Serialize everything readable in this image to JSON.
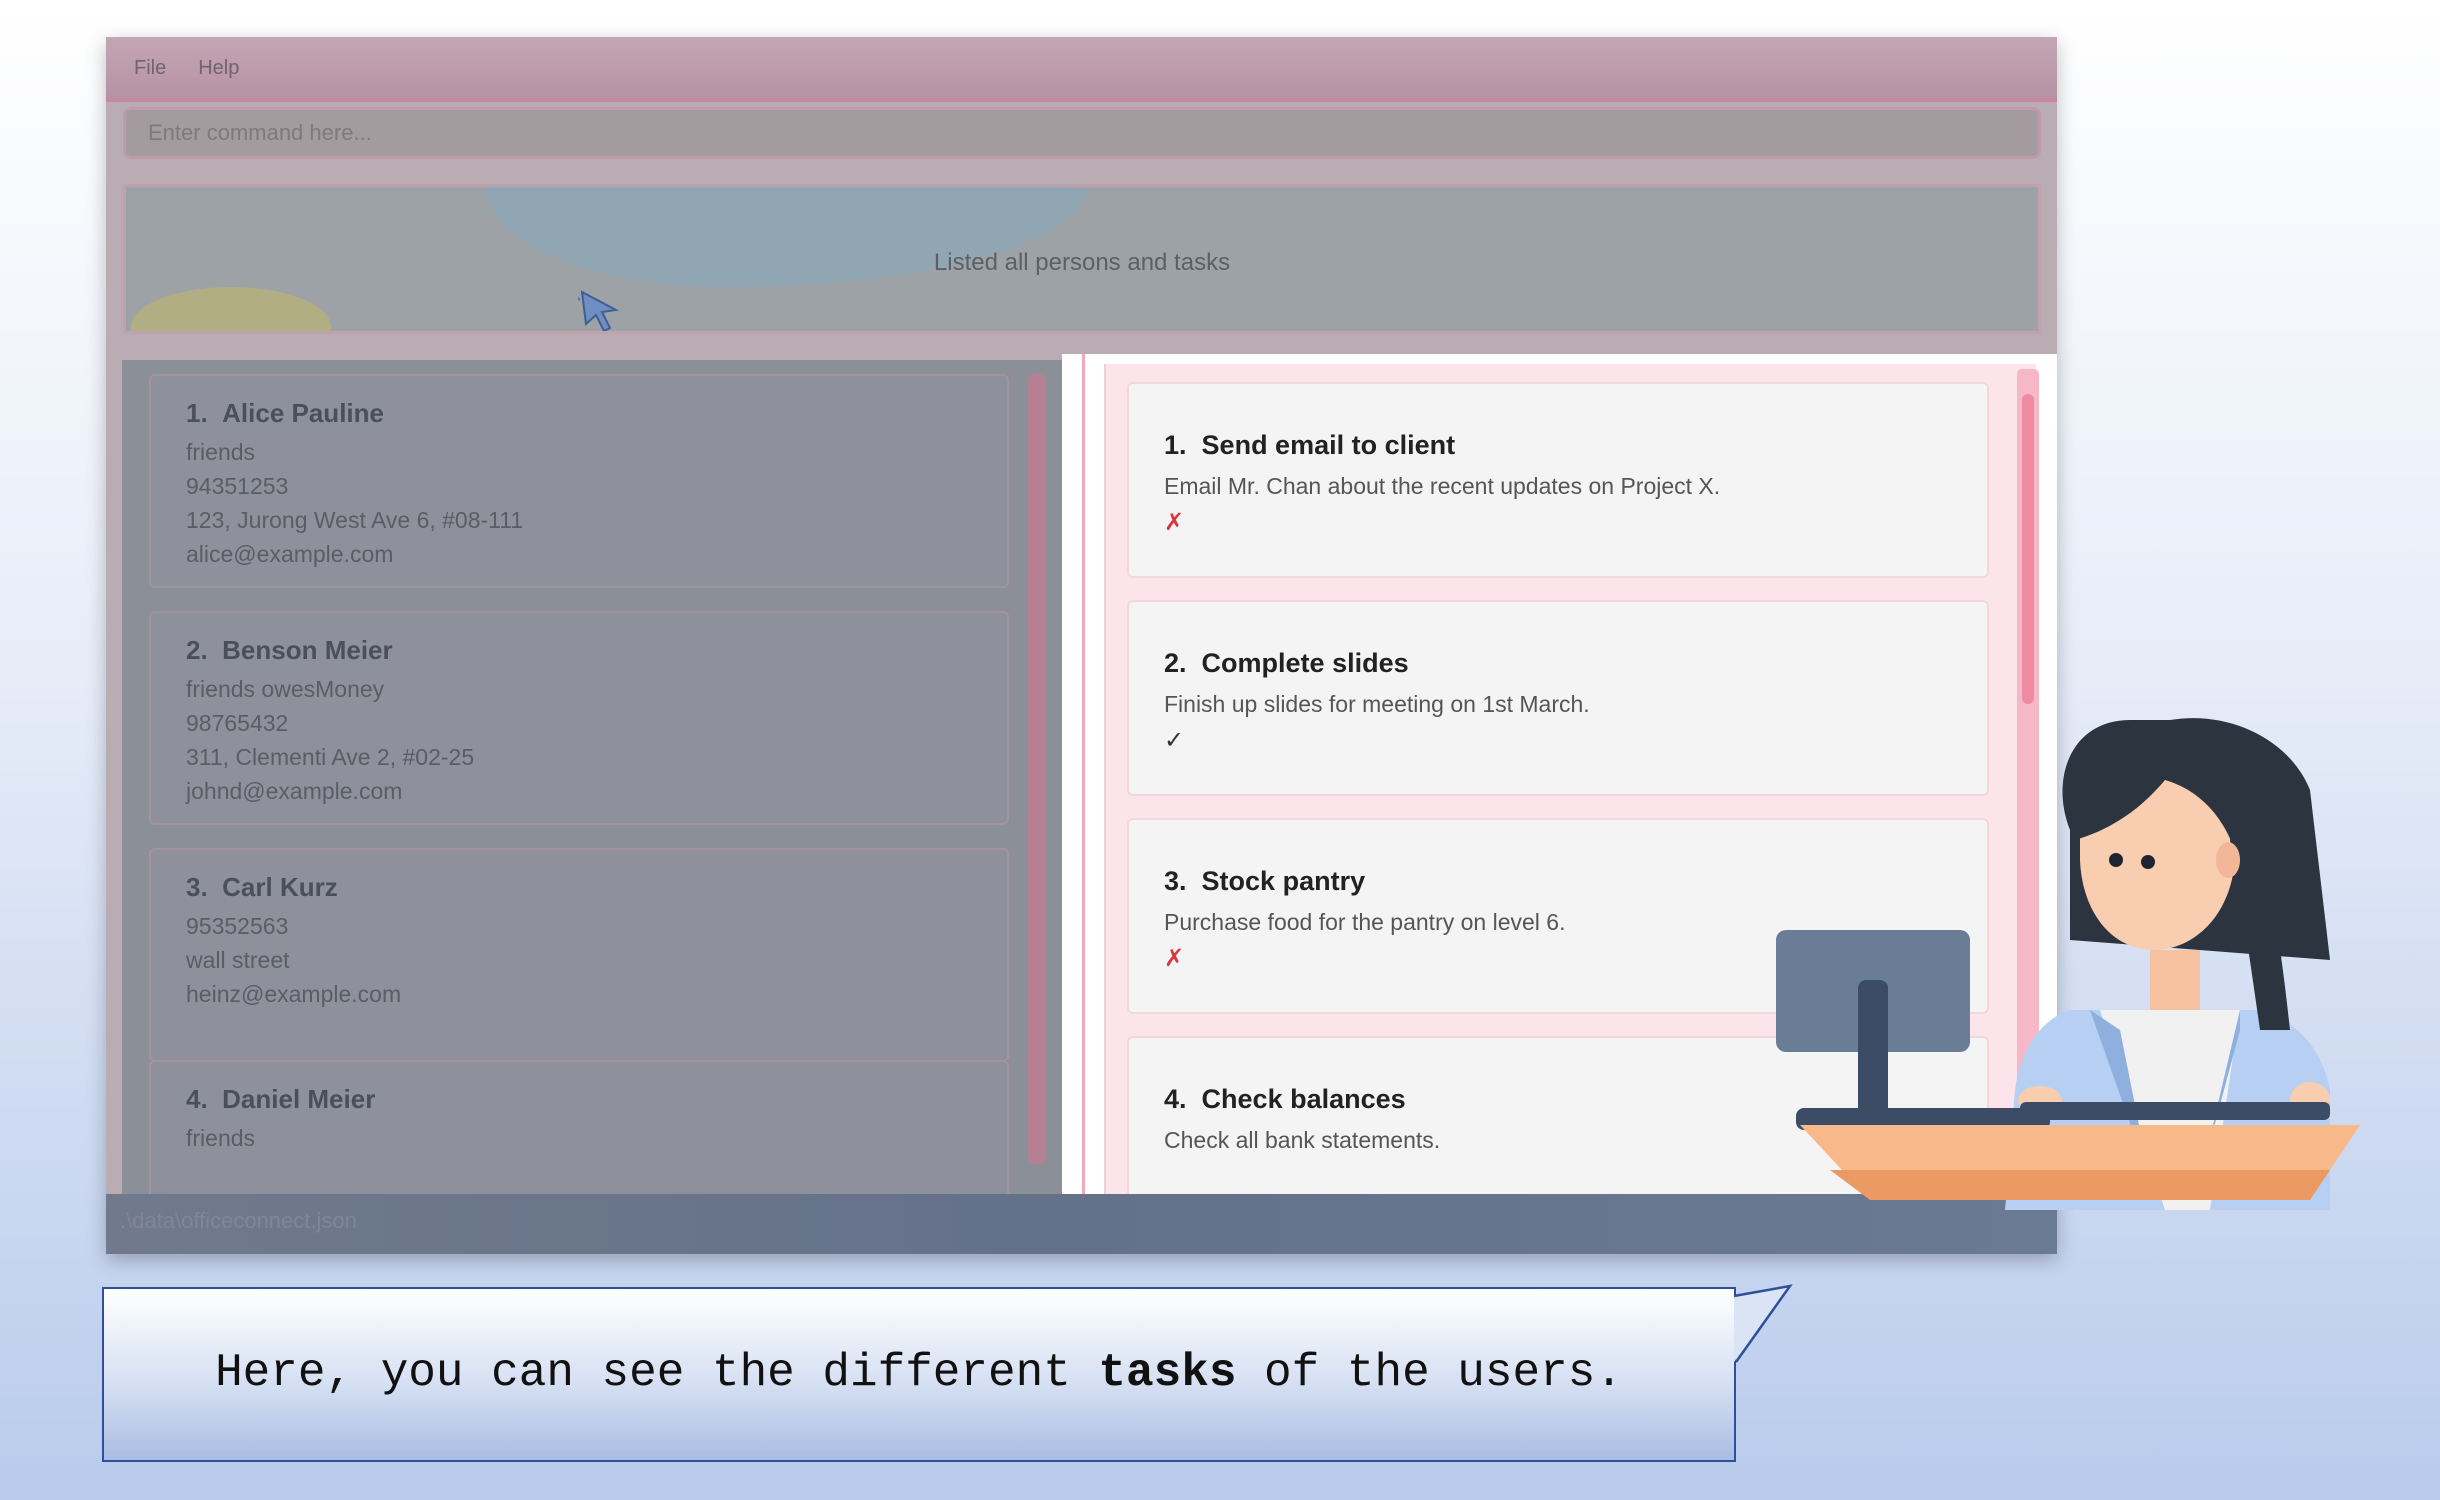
{
  "menu": {
    "file": "File",
    "help": "Help"
  },
  "command": {
    "placeholder": "Enter command here..."
  },
  "result": {
    "message": "Listed all persons and tasks"
  },
  "persons": [
    {
      "index": "1.",
      "name": "Alice Pauline",
      "tags": "friends",
      "phone": "94351253",
      "address": "123, Jurong West Ave 6, #08-111",
      "email": "alice@example.com"
    },
    {
      "index": "2.",
      "name": "Benson Meier",
      "tags": "friends  owesMoney",
      "phone": "98765432",
      "address": "311, Clementi Ave 2, #02-25",
      "email": "johnd@example.com"
    },
    {
      "index": "3.",
      "name": "Carl Kurz",
      "phone": "95352563",
      "address": "wall street",
      "email": "heinz@example.com"
    },
    {
      "index": "4.",
      "name": "Daniel Meier",
      "tags": "friends"
    }
  ],
  "tasks": [
    {
      "index": "1.",
      "title": "Send email to client",
      "description": "Email Mr. Chan about the recent updates on Project X.",
      "status": "✗",
      "status_color": "#d9363e"
    },
    {
      "index": "2.",
      "title": "Complete slides",
      "description": "Finish up slides for meeting on 1st March.",
      "status": "✓",
      "status_color": "#333333"
    },
    {
      "index": "3.",
      "title": "Stock pantry",
      "description": "Purchase food for the pantry on level 6.",
      "status": "✗",
      "status_color": "#d9363e"
    },
    {
      "index": "4.",
      "title": "Check balances",
      "description": "Check all bank statements."
    }
  ],
  "status_bar": {
    "path": ".\\data\\officeconnect.json"
  },
  "callout": {
    "before": "Here, you can see the different ",
    "emphasis": "tasks",
    "after": " of the users."
  },
  "icons": {
    "cursor": "cursor-arrow-icon",
    "character": "office-worker-illustration"
  }
}
